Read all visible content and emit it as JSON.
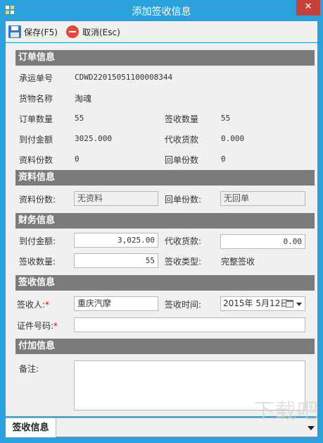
{
  "window": {
    "title": "添加签收信息",
    "close_glyph": "✕"
  },
  "toolbar": {
    "save_label": "保存(F5)",
    "cancel_label": "取消(Esc)"
  },
  "order_info": {
    "header": "订单信息",
    "tracking_no_label": "承运单号",
    "tracking_no": "CDWD22015051100008344",
    "goods_name_label": "货物名称",
    "goods_name": "淘魂",
    "order_qty_label": "订单数量",
    "order_qty": "55",
    "sign_qty_label": "签收数量",
    "sign_qty": "55",
    "cod_amount_label": "到付金额",
    "cod_amount": "3025.000",
    "collect_label": "代收货款",
    "collect": "0.000",
    "doc_count_label": "资料份数",
    "doc_count": "0",
    "receipt_count_label": "回单份数",
    "receipt_count": "0"
  },
  "doc_info": {
    "header": "资料信息",
    "doc_count_label": "资料份数:",
    "doc_count_value": "无资料",
    "receipt_label": "回单份数:",
    "receipt_value": "无回单"
  },
  "finance_info": {
    "header": "财务信息",
    "cod_label": "到付金额:",
    "cod_value": "3,025.00",
    "collect_label": "代收货款:",
    "collect_value": "0.00",
    "sign_qty_label": "签收数量:",
    "sign_qty_value": "55",
    "sign_type_label": "签收类型:",
    "sign_type_value": "完整签收"
  },
  "sign_info": {
    "header": "签收信息",
    "signer_label": "签收人:",
    "signer_value": "重庆汽摩",
    "sign_time_label": "签收时间:",
    "sign_time_value": "2015年 5月12日",
    "id_no_label": "证件号码:",
    "id_no_value": "",
    "required_mark": "*"
  },
  "extra_info": {
    "header": "付加信息",
    "remark_label": "备注:",
    "remark_value": ""
  },
  "bottom_tab": {
    "label": "签收信息"
  },
  "watermark": "下载吧",
  "colors": {
    "titlebar": "#2aa1dc",
    "section_header": "#7b7b7b",
    "close": "#c7413b"
  }
}
